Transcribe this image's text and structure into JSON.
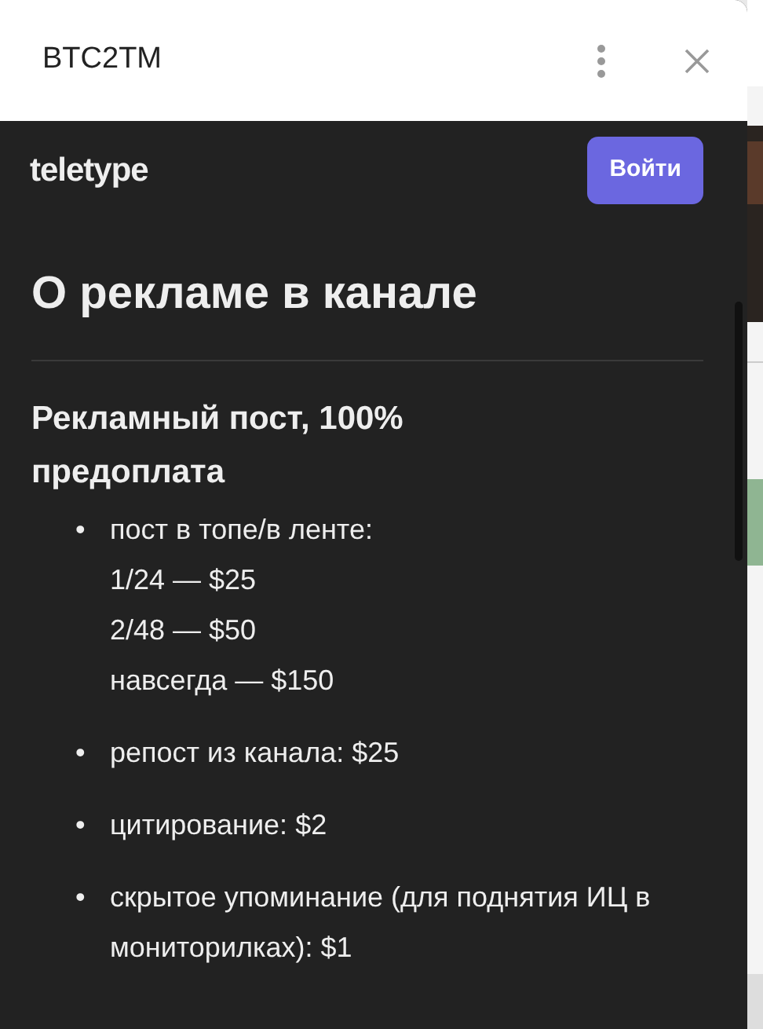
{
  "window": {
    "title": "BTC2TM"
  },
  "site_header": {
    "logo": "teletype",
    "login_button": "Войти"
  },
  "article": {
    "title": "О рекламе в канале",
    "section_title": "Рекламный пост, 100% предоплата",
    "items": [
      {
        "bullet": "•",
        "lines": [
          "пост в топе/в ленте:",
          "1/24 — $25",
          "2/48 — $50",
          "навсегда — $150"
        ]
      },
      {
        "bullet": "•",
        "lines": [
          "репост из канала: $25"
        ]
      },
      {
        "bullet": "•",
        "lines": [
          "цитирование: $2"
        ]
      },
      {
        "bullet": "•",
        "lines": [
          "скрытое упоминание (для поднятия ИЦ в мониторилках): $1"
        ]
      }
    ]
  }
}
